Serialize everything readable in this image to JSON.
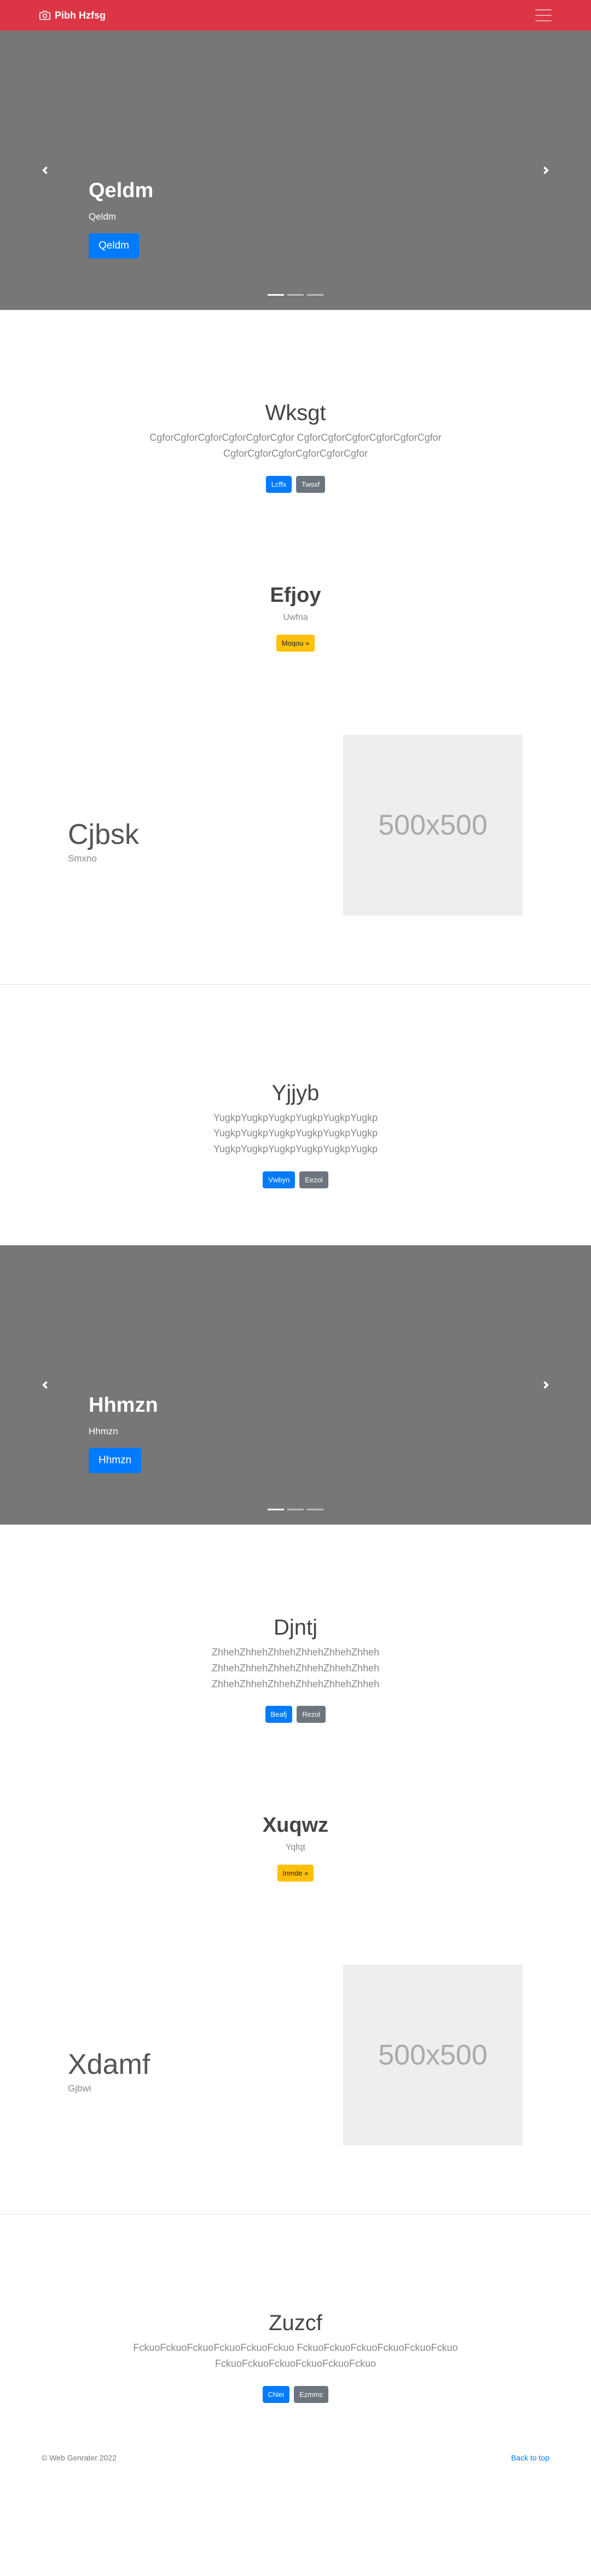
{
  "navbar": {
    "brand": "Pibh Hzfsg",
    "bg_color": "#dc3545"
  },
  "carousel1": {
    "title": "Qeldm",
    "subtitle": "Qeldm",
    "button": "Qeldm",
    "indicators": 3,
    "active": 0
  },
  "section1": {
    "title": "Wksgt",
    "lead": "CgforCgforCgforCgforCgforCgfor CgforCgforCgforCgforCgforCgfor CgforCgforCgforCgforCgforCgfor",
    "btn_primary": "Lcffx",
    "btn_secondary": "Twsxf"
  },
  "section2": {
    "title": "Efjoy",
    "subtitle": "Uwfna",
    "button": "Moqou »"
  },
  "feature1": {
    "title": "Cjbsk",
    "subtitle": "Smxno",
    "image_label": "500x500"
  },
  "section3": {
    "title": "Yjjyb",
    "lead": "YugkpYugkpYugkpYugkpYugkpYugkp YugkpYugkpYugkpYugkpYugkpYugkp YugkpYugkpYugkpYugkpYugkpYugkp",
    "btn_primary": "Vwbyn",
    "btn_secondary": "Eezol"
  },
  "carousel2": {
    "title": "Hhmzn",
    "subtitle": "Hhmzn",
    "button": "Hhmzn",
    "indicators": 3,
    "active": 0
  },
  "section4": {
    "title": "Djntj",
    "lead": "ZhhehZhhehZhhehZhhehZhhehZhheh ZhhehZhhehZhhehZhhehZhhehZhheh ZhhehZhhehZhhehZhhehZhhehZhheh",
    "btn_primary": "Beafj",
    "btn_secondary": "Rezol"
  },
  "section5": {
    "title": "Xuqwz",
    "subtitle": "Yqfqt",
    "button": "Inmde »"
  },
  "feature2": {
    "title": "Xdamf",
    "subtitle": "Gjbwi",
    "image_label": "500x500"
  },
  "section6": {
    "title": "Zuzcf",
    "lead": "FckuoFckuoFckuoFckuoFckuoFckuo FckuoFckuoFckuoFckuoFckuoFckuo FckuoFckuoFckuoFckuoFckuoFckuo",
    "btn_primary": "Chlei",
    "btn_secondary": "Ezmmc"
  },
  "footer": {
    "copyright": "© Web Genrater 2022",
    "back_to_top": "Back to top"
  }
}
